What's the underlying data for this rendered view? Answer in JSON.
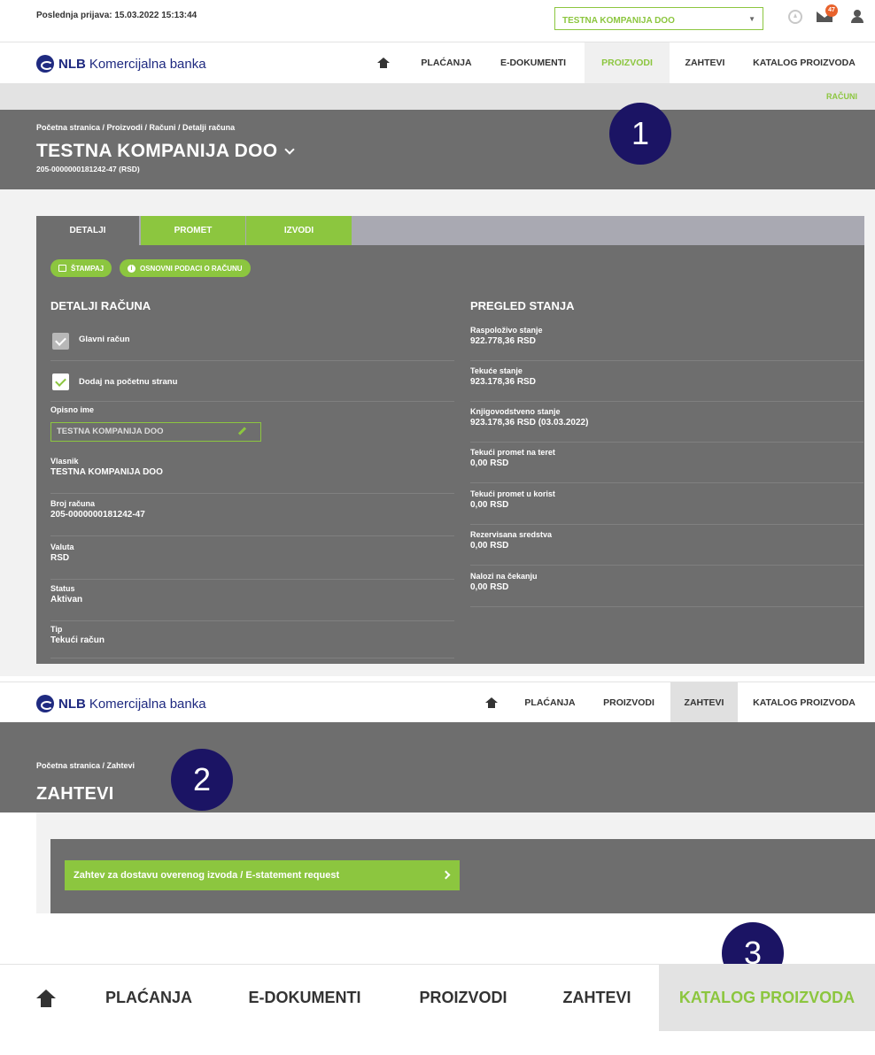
{
  "topbar": {
    "last_login": "Poslednja prijava: 15.03.2022 15:13:44",
    "company": "TESTNA KOMPANIJA DOO",
    "mail_badge": "47"
  },
  "brand": {
    "nlb": "NLB",
    "rest": "Komercijalna banka"
  },
  "nav1": [
    "PLAĆANJA",
    "E-DOKUMENTI",
    "PROIZVODI",
    "ZAHTEVI",
    "KATALOG PROIZVODA"
  ],
  "subnav": {
    "racuni": "RAČUNI"
  },
  "section1": {
    "breadcrumb": "Početna stranica  /  Proizvodi  /  Računi  /  Detalji računa",
    "title": "TESTNA KOMPANIJA DOO",
    "account": "205-0000000181242-47 (RSD)"
  },
  "markers": [
    "1",
    "2",
    "3"
  ],
  "tabs": [
    "DETALJI",
    "PROMET",
    "IZVODI"
  ],
  "actions": {
    "print": "ŠTAMPAJ",
    "basic_info": "OSNOVNI PODACI O RAČUNU"
  },
  "details": {
    "title": "DETALJI RAČUNA",
    "main_account": "Glavni račun",
    "add_home": "Dodaj na početnu stranu",
    "nickname_label": "Opisno ime",
    "nickname_value": "TESTNA KOMPANIJA DOO",
    "owner_label": "Vlasnik",
    "owner_value": "TESTNA KOMPANIJA DOO",
    "number_label": "Broj računa",
    "number_value": "205-0000000181242-47",
    "currency_label": "Valuta",
    "currency_value": "RSD",
    "status_label": "Status",
    "status_value": "Aktivan",
    "type_label": "Tip",
    "type_value": "Tekući račun"
  },
  "balance": {
    "title": "PREGLED STANJA",
    "rows": [
      {
        "label": "Raspoloživo stanje",
        "value": "922.778,36 RSD"
      },
      {
        "label": "Tekuće stanje",
        "value": "923.178,36 RSD"
      },
      {
        "label": "Knjigovodstveno stanje",
        "value": "923.178,36 RSD (03.03.2022)"
      },
      {
        "label": "Tekući promet na teret",
        "value": "0,00 RSD"
      },
      {
        "label": "Tekući promet u korist",
        "value": "0,00 RSD"
      },
      {
        "label": "Rezervisana sredstva",
        "value": "0,00 RSD"
      },
      {
        "label": "Nalozi na čekanju",
        "value": "0,00 RSD"
      }
    ]
  },
  "nav2": [
    "PLAĆANJA",
    "PROIZVODI",
    "ZAHTEVI",
    "KATALOG PROIZVODA"
  ],
  "section2": {
    "breadcrumb": "Početna stranica  /  Zahtevi",
    "title": "ZAHTEVI",
    "request_button": "Zahtev za dostavu overenog izvoda / E-statement request"
  },
  "nav3": [
    "PLAĆANJA",
    "E-DOKUMENTI",
    "PROIZVODI",
    "ZAHTEVI",
    "KATALOG PROIZVODA"
  ]
}
